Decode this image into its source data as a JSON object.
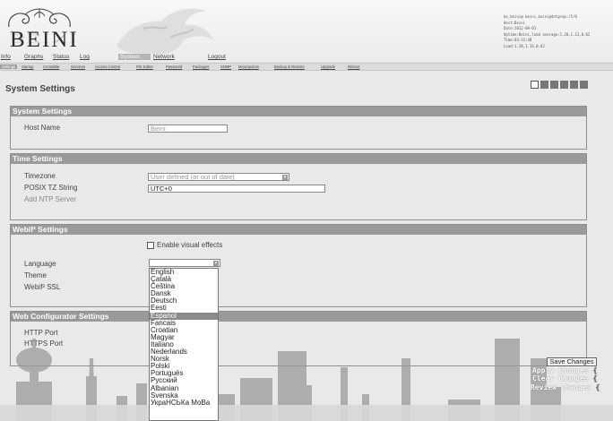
{
  "header": {
    "logo": "BEINI",
    "sysinfo": "be_beini@ beini_beini@dotgrep:/5/6\nHost:Beini\nDate:2012-09-03\nUptime:Beini,load average:1.28,1.13,0.62\nTime:03:33:48\nLoad:1.28,1.13,0.62"
  },
  "nav": {
    "tabs": [
      "Info",
      "Graphs",
      "Status",
      "Log",
      "System",
      "Network",
      "Logout"
    ]
  },
  "subnav": {
    "items": [
      "Settings",
      "Startup",
      "Crontable",
      "Services",
      "Access Control",
      "File Editor",
      "Password",
      "Packages",
      "SNMP",
      "Mountpoints",
      "Backup & Restore",
      "Upgrade",
      "Reboot"
    ]
  },
  "page": {
    "title": "System Settings"
  },
  "sections": {
    "system": {
      "title": "System Settings",
      "host_label": "Host Name",
      "host_value": "Beini"
    },
    "time": {
      "title": "Time Settings",
      "tz_label": "Timezone",
      "tz_value": "User defined (or out of date)",
      "posix_label": "POSIX TZ String",
      "posix_value": "UTC+0",
      "ntp_label": "Add NTP Server"
    },
    "webif": {
      "title": "Webif² Settings",
      "visual_label": "Enable visual effects",
      "language_label": "Language",
      "theme_label": "Theme",
      "ssl_label": "Webif² SSL"
    },
    "webcfg": {
      "title": "Web Configurator Settings",
      "http_label": "HTTP Port",
      "https_label": "HTTPS Port"
    }
  },
  "language_options": [
    "English",
    "Català",
    "Čeština",
    "Dansk",
    "Deutsch",
    "Eesti",
    "Espanol",
    "Fancais",
    "Croatian",
    "Magyar",
    "Italiano",
    "Nederlands",
    "Norsk",
    "Polski",
    "Portuguës",
    "Русский",
    "Albanian",
    "Svenska",
    "УкраНСЬКа МоВа"
  ],
  "language_highlighted": "Espanol",
  "actions": {
    "save": "Save Changes",
    "apply": "Apply Changes",
    "clear": "Clear Changes",
    "review": "Review Changes",
    "bracket": "{"
  },
  "colors": {
    "section_header": "#9a9a9a",
    "nav_active": "#b4b4b4",
    "highlight": "#8a8a8a"
  }
}
